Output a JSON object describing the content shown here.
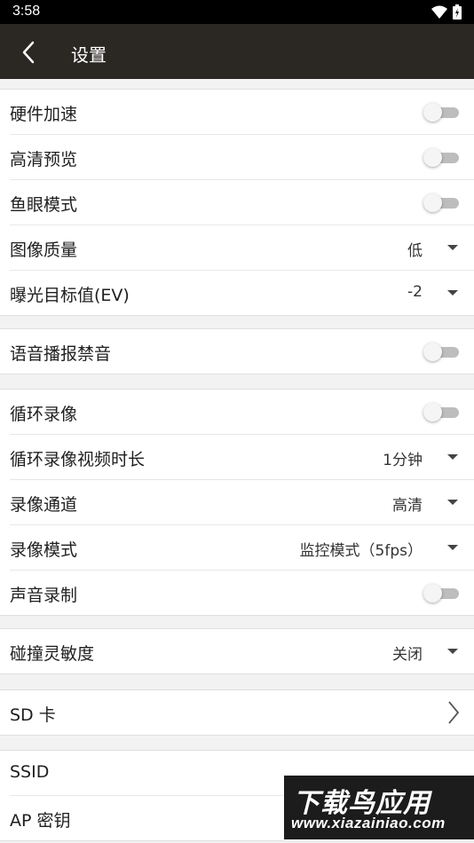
{
  "status_bar": {
    "time": "3:58"
  },
  "app_bar": {
    "title": "设置"
  },
  "groups": [
    {
      "rows": [
        {
          "label": "硬件加速",
          "toggle": false
        },
        {
          "label": "高清预览",
          "toggle": false
        },
        {
          "label": "鱼眼模式",
          "toggle": false
        },
        {
          "label": "图像质量",
          "value": "低"
        },
        {
          "label": "曝光目标值(EV)",
          "value": "-2"
        }
      ]
    },
    {
      "rows": [
        {
          "label": "语音播报禁音",
          "toggle": false
        }
      ]
    },
    {
      "rows": [
        {
          "label": "循环录像",
          "toggle": false
        },
        {
          "label": "循环录像视频时长",
          "value": "1分钟"
        },
        {
          "label": "录像通道",
          "value": "高清"
        },
        {
          "label": "录像模式",
          "value": "监控模式（5fps）"
        },
        {
          "label": "声音录制",
          "toggle": false
        }
      ]
    },
    {
      "rows": [
        {
          "label": "碰撞灵敏度",
          "value": "关闭"
        }
      ]
    },
    {
      "rows": [
        {
          "label": "SD 卡"
        }
      ]
    },
    {
      "rows": [
        {
          "label": "SSID"
        },
        {
          "label": "AP 密钥"
        }
      ]
    }
  ],
  "watermark": {
    "title": "下载鸟应用",
    "url": "www.xiazainiao.com"
  },
  "colors": {
    "app_bar": "#2b2824",
    "background": "#f2f2f2",
    "toggle_off": "#bdbdbd"
  }
}
